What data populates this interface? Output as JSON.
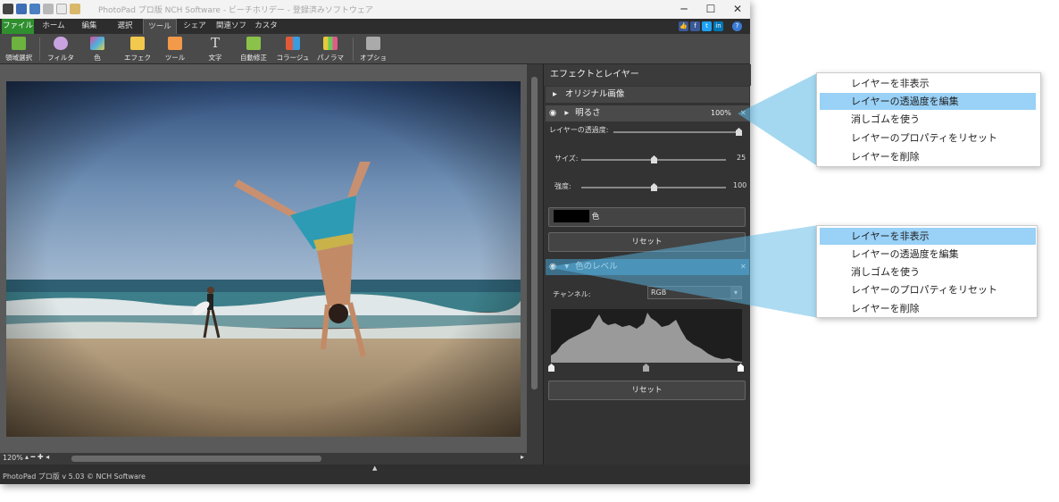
{
  "window": {
    "title": "PhotoPad プロ版 NCH Software - ビーチホリデー - 登録済みソフトウェア",
    "controls": {
      "minimize": "─",
      "maximize": "☐",
      "close": "✕"
    }
  },
  "menu": {
    "tabs": [
      "ファイル",
      "ホーム",
      "編集",
      "選択",
      "ツール",
      "シェア",
      "関連ソフト",
      "カスタム"
    ],
    "active": "ツール",
    "right_icons": [
      "like-icon",
      "facebook-icon",
      "twitter-icon",
      "linkedin-icon",
      "help-icon"
    ]
  },
  "toolbar": {
    "tools": [
      {
        "label": "領域選択",
        "icon": "region-select-icon",
        "color": "#6db33f"
      },
      {
        "label": "フィルタ",
        "icon": "filter-icon",
        "color": "#c9a3e0"
      },
      {
        "label": "色",
        "icon": "color-icon",
        "color": "#e04b9a"
      },
      {
        "label": "エフェクト",
        "icon": "effect-icon",
        "color": "#f2c94c"
      },
      {
        "label": "ツール",
        "icon": "tool-icon",
        "color": "#f2994a"
      },
      {
        "label": "文字",
        "icon": "text-icon",
        "color": "#dddddd"
      },
      {
        "label": "自動修正",
        "icon": "auto-fix-icon",
        "color": "#8bc34a"
      },
      {
        "label": "コラージュ",
        "icon": "collage-icon",
        "color": "#e05a3a"
      },
      {
        "label": "パノラマ",
        "icon": "panorama-icon",
        "color": "#e8c93a"
      },
      {
        "label": "オプション",
        "icon": "options-icon",
        "color": "#aaaaaa"
      }
    ]
  },
  "canvas": {
    "zoom": "120%"
  },
  "status": {
    "text": "PhotoPad プロ版 v 5.03 © NCH Software"
  },
  "panel": {
    "title": "エフェクトとレイヤー",
    "original": "オリジナル画像",
    "layer1": {
      "name": "明るさ",
      "opacity": "100%",
      "opacity_label": "レイヤーの透過度:",
      "size_label": "サイズ:",
      "size_value": "25",
      "strength_label": "強度:",
      "strength_value": "100",
      "color_label": "色",
      "color_swatch": "#000000",
      "reset": "リセット"
    },
    "layer2": {
      "name": "色のレベル",
      "channel_label": "チャンネル:",
      "channel_value": "RGB",
      "reset": "リセット"
    }
  },
  "popup1": {
    "items": [
      "レイヤーを非表示",
      "レイヤーの透過度を編集",
      "消しゴムを使う",
      "レイヤーのプロパティをリセット",
      "レイヤーを削除"
    ],
    "highlighted": 1
  },
  "popup2": {
    "items": [
      "レイヤーを非表示",
      "レイヤーの透過度を編集",
      "消しゴムを使う",
      "レイヤーのプロパティをリセット",
      "レイヤーを削除"
    ],
    "highlighted": 0
  },
  "colors": {
    "accent_green": "#2f8f2f",
    "highlight_blue": "#99d1f7",
    "beam": "#5ab8e6"
  }
}
